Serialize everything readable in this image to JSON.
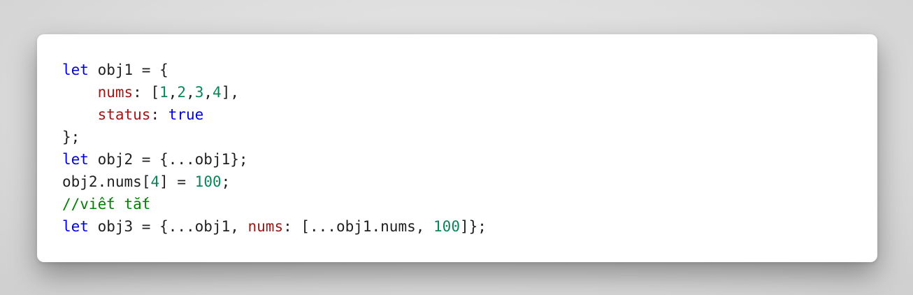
{
  "code": {
    "lines": [
      [
        {
          "t": "let",
          "c": "kw"
        },
        {
          "t": " obj1 = {",
          "c": "plain"
        }
      ],
      [
        {
          "t": "    ",
          "c": "plain"
        },
        {
          "t": "nums",
          "c": "prop"
        },
        {
          "t": ": [",
          "c": "plain"
        },
        {
          "t": "1",
          "c": "num"
        },
        {
          "t": ",",
          "c": "plain"
        },
        {
          "t": "2",
          "c": "num"
        },
        {
          "t": ",",
          "c": "plain"
        },
        {
          "t": "3",
          "c": "num"
        },
        {
          "t": ",",
          "c": "plain"
        },
        {
          "t": "4",
          "c": "num"
        },
        {
          "t": "],",
          "c": "plain"
        }
      ],
      [
        {
          "t": "    ",
          "c": "plain"
        },
        {
          "t": "status",
          "c": "prop"
        },
        {
          "t": ": ",
          "c": "plain"
        },
        {
          "t": "true",
          "c": "kw"
        }
      ],
      [
        {
          "t": "};",
          "c": "plain"
        }
      ],
      [
        {
          "t": "let",
          "c": "kw"
        },
        {
          "t": " obj2 = {...obj1};",
          "c": "plain"
        }
      ],
      [
        {
          "t": "obj2.nums[",
          "c": "plain"
        },
        {
          "t": "4",
          "c": "num"
        },
        {
          "t": "] = ",
          "c": "plain"
        },
        {
          "t": "100",
          "c": "num"
        },
        {
          "t": ";",
          "c": "plain"
        }
      ],
      [
        {
          "t": "//viết tắt",
          "c": "cmt"
        }
      ],
      [
        {
          "t": "let",
          "c": "kw"
        },
        {
          "t": " obj3 = {...obj1, ",
          "c": "plain"
        },
        {
          "t": "nums",
          "c": "prop"
        },
        {
          "t": ": [...obj1.nums, ",
          "c": "plain"
        },
        {
          "t": "100",
          "c": "num"
        },
        {
          "t": "]};",
          "c": "plain"
        }
      ]
    ]
  },
  "colors": {
    "keyword": "#0000e6",
    "property": "#a31515",
    "number": "#098658",
    "comment": "#008000",
    "text": "#1f1f1f",
    "card": "#ffffff"
  }
}
